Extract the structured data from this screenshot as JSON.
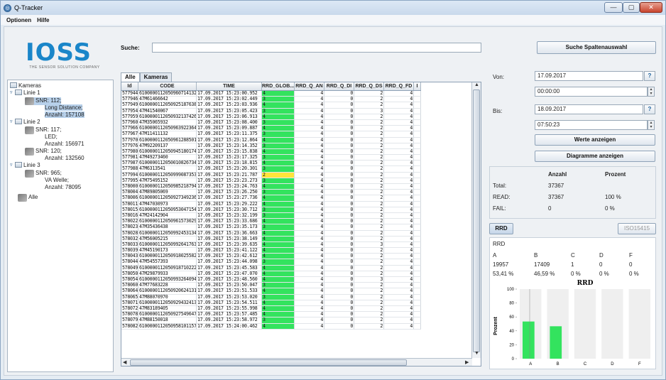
{
  "window": {
    "title": "Q-Tracker",
    "minimize": "—",
    "maximize": "▢",
    "close": "✕"
  },
  "menu": [
    "Optionen",
    "Hilfe"
  ],
  "logo": {
    "text": "IOSS",
    "tagline": "THE SENSOR SOLUTION COMPANY"
  },
  "search": {
    "label": "Suche:",
    "value": "",
    "column_button": "Suche Spaltenauswahl"
  },
  "tree": {
    "root": "Kameras",
    "items": [
      {
        "label": "Linie 1",
        "type": "folder",
        "level": 1
      },
      {
        "label": "SNR: 112;",
        "type": "camera",
        "level": 2,
        "selected": true
      },
      {
        "label": "Long Distance;",
        "type": "cont",
        "level": 2,
        "selected": true
      },
      {
        "label": "Anzahl: 157108",
        "type": "cont",
        "level": 2,
        "selected": true
      },
      {
        "label": "Linie 2",
        "type": "folder",
        "level": 1
      },
      {
        "label": "SNR: 117;",
        "type": "camera",
        "level": 2
      },
      {
        "label": "LED;",
        "type": "cont",
        "level": 2
      },
      {
        "label": "Anzahl: 156971",
        "type": "cont",
        "level": 2
      },
      {
        "label": "SNR: 120;",
        "type": "camera",
        "level": 2
      },
      {
        "label": "Anzahl: 132560",
        "type": "cont",
        "level": 2
      },
      {
        "label": "Linie 3",
        "type": "folder",
        "level": 1
      },
      {
        "label": "SNR: 965;",
        "type": "camera",
        "level": 2
      },
      {
        "label": "VA Welle;",
        "type": "cont",
        "level": 2
      },
      {
        "label": "Anzahl: 78095",
        "type": "cont",
        "level": 2
      },
      {
        "label": "Alle",
        "type": "camera",
        "level": 0
      }
    ]
  },
  "tabs": [
    "Alle",
    "Kameras"
  ],
  "table": {
    "columns": [
      "Id",
      "CODE",
      "TIME",
      "RRD_GLOB...",
      "RRD_Q_AN",
      "RRD_Q_DI",
      "RRD_Q_DS",
      "RRD_Q_FD",
      "I"
    ],
    "rows": [
      [
        "577944",
        "6100000112050960714132",
        "17.09.2017 15:23:00.952",
        "4",
        "4",
        "0",
        "2",
        "4"
      ],
      [
        "577946",
        "47M61466642",
        "17.09.2017 15:23:02.449",
        "3",
        "4",
        "0",
        "2",
        "4"
      ],
      [
        "577949",
        "6100000112050925187638",
        "17.09.2017 15:23:03.936",
        "4",
        "4",
        "0",
        "2",
        "4"
      ],
      [
        "577954",
        "47M41540067",
        "17.09.2017 15:23:05.423",
        "3",
        "4",
        "0",
        "3",
        "4"
      ],
      [
        "577959",
        "6100000112050932137426",
        "17.09.2017 15:23:06.913",
        "4",
        "4",
        "0",
        "2",
        "4"
      ],
      [
        "577960",
        "47M35065932",
        "17.09.2017 15:23:08.400",
        "3",
        "4",
        "0",
        "2",
        "4"
      ],
      [
        "577966",
        "6100000112050963922364",
        "17.09.2017 15:23:09.887",
        "4",
        "4",
        "0",
        "2",
        "4"
      ],
      [
        "577967",
        "47M11411132",
        "17.09.2017 15:23:11.375",
        "3",
        "4",
        "0",
        "2",
        "4"
      ],
      [
        "577970",
        "6100000112050961288501",
        "17.09.2017 15:23:12.864",
        "4",
        "4",
        "0",
        "2",
        "4"
      ],
      [
        "577976",
        "47M92209137",
        "17.09.2017 15:23:14.352",
        "3",
        "4",
        "0",
        "2",
        "4"
      ],
      [
        "577980",
        "6100000112050945180174",
        "17.09.2017 15:23:15.838",
        "4",
        "4",
        "0",
        "2",
        "4"
      ],
      [
        "577981",
        "47M49273460",
        "17.09.2017 15:23:17.325",
        "3",
        "4",
        "0",
        "2",
        "4"
      ],
      [
        "577987",
        "6100000112050010826734",
        "17.09.2017 15:23:18.815",
        "4",
        "4",
        "0",
        "2",
        "4"
      ],
      [
        "577988",
        "47M6313541",
        "17.09.2017 15:23:20.301",
        "3",
        "4",
        "0",
        "2",
        "4"
      ],
      [
        "577994",
        "6100000112050999087353",
        "17.09.2017 15:23:21.787",
        "2",
        "4",
        "0",
        "2",
        "4"
      ],
      [
        "577995",
        "47M75495152",
        "17.09.2017 15:23:23.273",
        "3",
        "4",
        "0",
        "2",
        "4"
      ],
      [
        "578000",
        "6100000112050985218794",
        "17.09.2017 15:23:24.763",
        "4",
        "4",
        "0",
        "2",
        "4"
      ],
      [
        "578004",
        "47M89805069",
        "17.09.2017 15:23:26.250",
        "3",
        "4",
        "0",
        "2",
        "4"
      ],
      [
        "578006",
        "6100000112050927349236",
        "17.09.2017 15:23:27.736",
        "4",
        "4",
        "0",
        "2",
        "4"
      ],
      [
        "578011",
        "47M47030973",
        "17.09.2017 15:23:29.222",
        "4",
        "4",
        "0",
        "2",
        "4"
      ],
      [
        "578015",
        "6100000112050953047154",
        "17.09.2017 15:23:30.712",
        "3",
        "4",
        "0",
        "2",
        "4"
      ],
      [
        "578016",
        "47M24142904",
        "17.09.2017 15:23:32.199",
        "3",
        "4",
        "0",
        "2",
        "4"
      ],
      [
        "578022",
        "6100000112050961573029",
        "17.09.2017 15:23:33.686",
        "4",
        "4",
        "0",
        "2",
        "4"
      ],
      [
        "578023",
        "47M35436438",
        "17.09.2017 15:23:35.173",
        "3",
        "4",
        "0",
        "2",
        "4"
      ],
      [
        "578028",
        "6100000112050992453134",
        "17.09.2017 15:23:36.663",
        "4",
        "4",
        "0",
        "2",
        "4"
      ],
      [
        "578032",
        "47M56005215",
        "17.09.2017 15:23:38.149",
        "4",
        "4",
        "0",
        "2",
        "4"
      ],
      [
        "578033",
        "6100000112050992641763",
        "17.09.2017 15:23:39.635",
        "4",
        "4",
        "0",
        "3",
        "4"
      ],
      [
        "578039",
        "47M45190173",
        "17.09.2017 15:23:41.122",
        "4",
        "4",
        "0",
        "2",
        "4"
      ],
      [
        "578043",
        "6100000112050918025582",
        "17.09.2017 15:23:42.612",
        "4",
        "4",
        "0",
        "2",
        "4"
      ],
      [
        "578044",
        "47M54557393",
        "17.09.2017 15:23:44.098",
        "3",
        "4",
        "0",
        "2",
        "4"
      ],
      [
        "578049",
        "6100000112050918710222",
        "17.09.2017 15:23:45.583",
        "4",
        "4",
        "0",
        "2",
        "4"
      ],
      [
        "578050",
        "47M29879933",
        "17.09.2017 15:23:47.070",
        "4",
        "4",
        "0",
        "2",
        "4"
      ],
      [
        "578054",
        "6100000112050993264094",
        "17.09.2017 15:23:48.560",
        "4",
        "4",
        "0",
        "3",
        "4"
      ],
      [
        "578060",
        "47M77683228",
        "17.09.2017 15:23:50.047",
        "3",
        "4",
        "0",
        "2",
        "4"
      ],
      [
        "578064",
        "6100000112050920624131",
        "17.09.2017 15:23:51.533",
        "4",
        "4",
        "0",
        "2",
        "4"
      ],
      [
        "578065",
        "47M88070970",
        "17.09.2017 15:23:53.020",
        "3",
        "4",
        "0",
        "2",
        "4"
      ],
      [
        "578071",
        "6100000112050929432413",
        "17.09.2017 15:23:54.511",
        "4",
        "4",
        "0",
        "2",
        "4"
      ],
      [
        "578072",
        "47M83189405",
        "17.09.2017 15:23:55.998",
        "4",
        "4",
        "0",
        "2",
        "4"
      ],
      [
        "578078",
        "6100000112050927549647",
        "17.09.2017 15:23:57.485",
        "4",
        "4",
        "0",
        "2",
        "4"
      ],
      [
        "578079",
        "47M88150018",
        "17.09.2017 15:23:58.972",
        "3",
        "4",
        "0",
        "2",
        "4"
      ],
      [
        "578082",
        "6100000112050958101157",
        "17.09.2017 15:24:00.462",
        "4",
        "4",
        "0",
        "2",
        "4"
      ]
    ]
  },
  "filter": {
    "from_label": "Von:",
    "from_date": "17.09.2017",
    "from_time": "00:00:00",
    "to_label": "Bis:",
    "to_date": "18.09.2017",
    "to_time": "07:50:23",
    "date_button": "?",
    "show_values": "Werte anzeigen",
    "show_charts": "Diagramme anzeigen"
  },
  "stats": {
    "col_count": "Anzahl",
    "col_percent": "Prozent",
    "rows": [
      {
        "label": "Total:",
        "count": "37367",
        "percent": ""
      },
      {
        "label": "READ:",
        "count": "37367",
        "percent": "100 %"
      },
      {
        "label": "FAIL:",
        "count": "0",
        "percent": "0 %"
      }
    ]
  },
  "rrd": {
    "tab": "RRD",
    "tab_right": "ISO15415",
    "title": "RRD",
    "grades": [
      "A",
      "B",
      "C",
      "D",
      "F"
    ],
    "counts": [
      "19957",
      "17409",
      "1",
      "0",
      "0"
    ],
    "percents": [
      "53,41 %",
      "46,59 %",
      "0 %",
      "0 %",
      "0 %"
    ]
  },
  "chart_data": {
    "type": "bar",
    "title": "RRD",
    "ylabel": "Prozent",
    "xlabel": "",
    "categories": [
      "A",
      "B",
      "C",
      "D",
      "F"
    ],
    "values": [
      53.41,
      46.59,
      0,
      0,
      0
    ],
    "ylim": [
      0,
      100
    ],
    "yticks": [
      "0",
      "20",
      "40",
      "60",
      "80",
      "100"
    ],
    "bar_color": "#33e35e",
    "bg_color": "#efefef"
  }
}
